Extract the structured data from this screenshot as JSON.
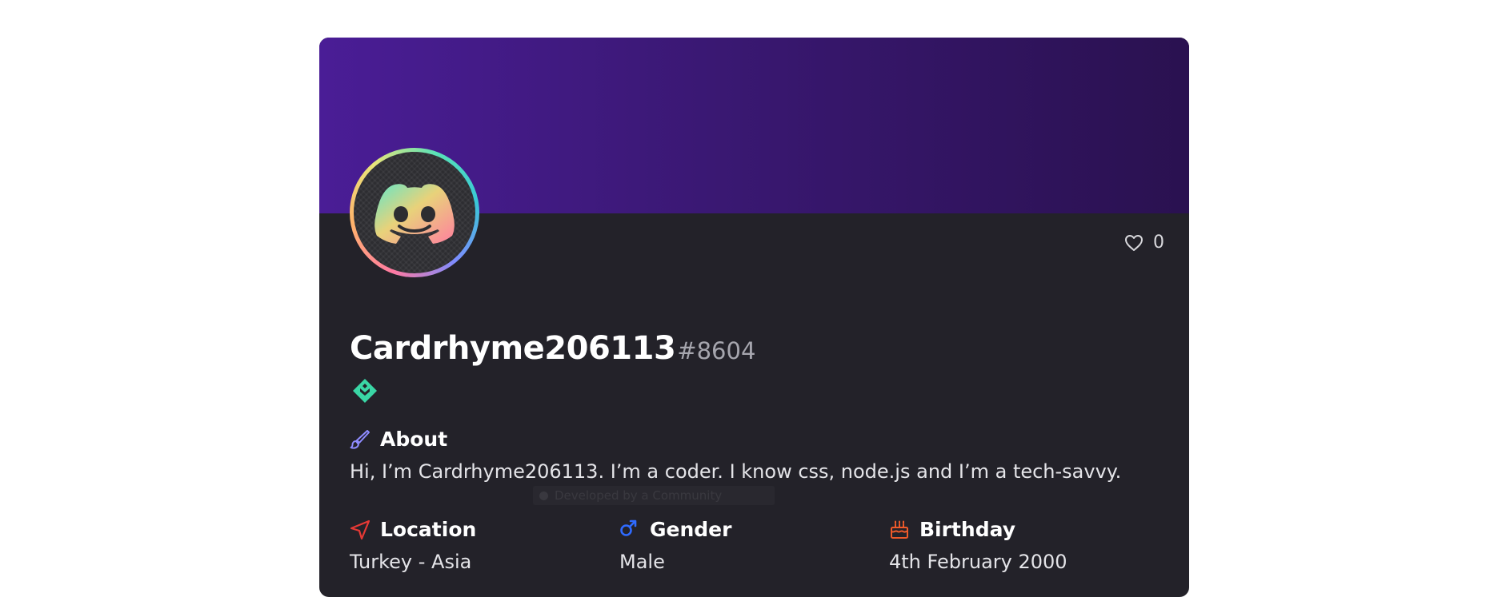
{
  "profile": {
    "username": "Cardrhyme206113",
    "discriminator": "#8604",
    "likes": "0"
  },
  "about": {
    "title": "About",
    "text": "Hi, I’m Cardrhyme206113. I’m a coder. I know css, node.js and I’m a tech-savvy."
  },
  "ghost_overlay": {
    "text": "Developed by a Community"
  },
  "info": {
    "location": {
      "title": "Location",
      "value": "Turkey - Asia"
    },
    "gender": {
      "title": "Gender",
      "value": "Male"
    },
    "birthday": {
      "title": "Birthday",
      "value": "4th February 2000"
    }
  },
  "colors": {
    "banner_start": "#4a1d96",
    "banner_end": "#2a1150",
    "card_bg": "#232229",
    "about_icon": "#8f8cff",
    "location_icon": "#e53935",
    "gender_icon": "#2f6bff",
    "birthday_icon": "#ef5a2a",
    "badge": "#3ad6a5"
  },
  "icons": {
    "like": "heart-icon",
    "about": "brush-icon",
    "location": "navigation-arrow-icon",
    "gender": "male-icon",
    "birthday": "cake-icon",
    "badge": "hypesquad-badge-icon",
    "avatar": "discord-logo-icon"
  }
}
